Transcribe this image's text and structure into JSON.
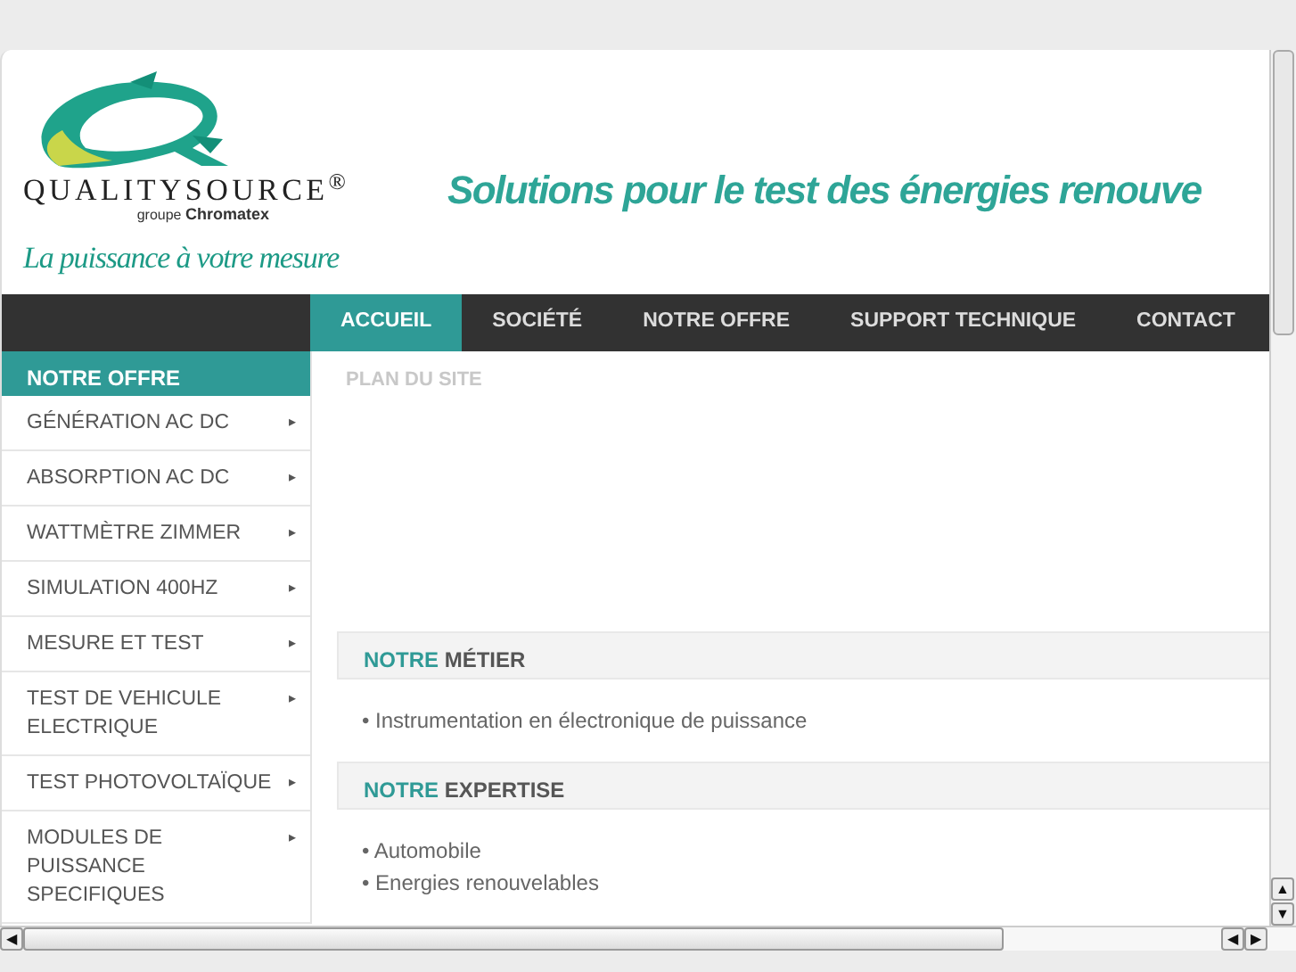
{
  "logo": {
    "brand": "QUALITYSOURCE$^{®}$",
    "group_prefix": "groupe",
    "group": "Chromatex",
    "tagline": "La puissance à votre mesure"
  },
  "headline": "Solutions pour le test des énergies renouve",
  "nav": [
    {
      "label": "ACCUEIL",
      "selected": true
    },
    {
      "label": "SOCIÉTÉ",
      "selected": false
    },
    {
      "label": "NOTRE OFFRE",
      "selected": false
    },
    {
      "label": "SUPPORT TECHNIQUE",
      "selected": false
    },
    {
      "label": "CONTACT",
      "selected": false
    }
  ],
  "sidebar": {
    "title": "NOTRE OFFRE",
    "items": [
      {
        "label": "GÉNÉRATION AC DC",
        "arrow": "▸"
      },
      {
        "label": "ABSORPTION AC DC",
        "arrow": "▸"
      },
      {
        "label": "WATTMÈTRE ZIMMER",
        "arrow": "▸"
      },
      {
        "label": "SIMULATION 400HZ",
        "arrow": "▸"
      },
      {
        "label": "MESURE ET TEST",
        "arrow": "▸"
      },
      {
        "label": "TEST DE VEHICULE ELECTRIQUE",
        "arrow": "▸"
      },
      {
        "label": "TEST PHOTOVOLTAÏQUE",
        "arrow": "▸"
      },
      {
        "label": "MODULES DE PUISSANCE SPECIFIQUES",
        "arrow": "▸"
      }
    ]
  },
  "scroll_arrows": {
    "up": "▲",
    "down": "▼",
    "left": "◀",
    "right": "▶"
  },
  "breadcrumb": "PLAN DU SITE",
  "sections": [
    {
      "accent": "NOTRE",
      "title": "MÉTIER",
      "items": [
        "• Instrumentation en électronique de puissance"
      ]
    },
    {
      "accent": "NOTRE",
      "title": "EXPERTISE",
      "items": [
        "• Automobile",
        "• Energies renouvelables"
      ]
    }
  ]
}
